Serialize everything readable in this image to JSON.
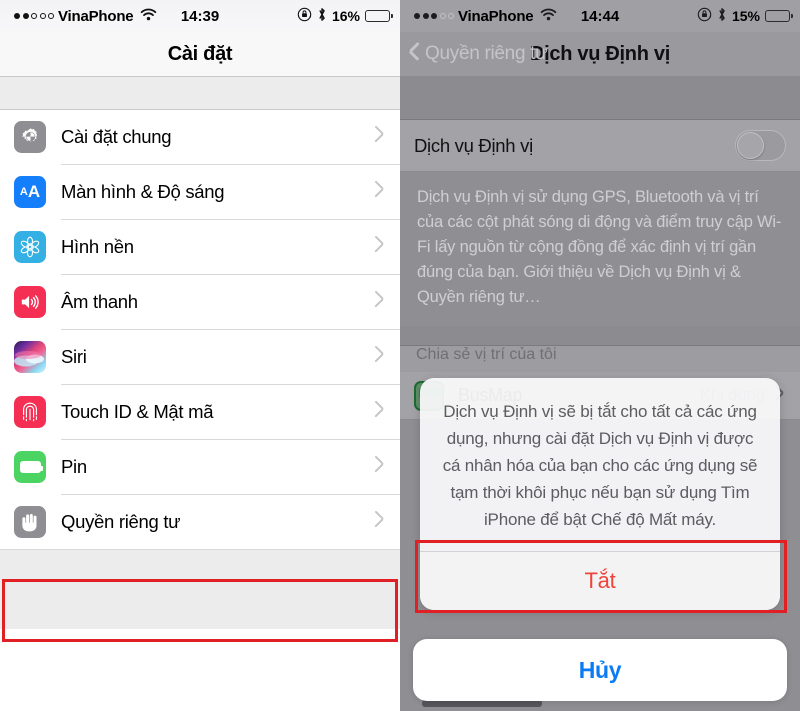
{
  "left": {
    "statusbar": {
      "signal_dots_filled": 2,
      "signal_dots_total": 5,
      "carrier": "VinaPhone",
      "wifi_icon": "wifi-icon",
      "time": "14:39",
      "rotation_lock_icon": "rotation-lock-icon",
      "bluetooth_icon": "bluetooth-icon",
      "battery_percent": "16%",
      "battery_level": 16,
      "battery_color": "#ffcc00"
    },
    "nav": {
      "title": "Cài đặt"
    },
    "list": [
      {
        "label": "Cài đặt chung",
        "icon": "gear-icon",
        "color": "#8e8e93"
      },
      {
        "label": "Màn hình & Độ sáng",
        "icon": "display-aa-icon",
        "color": "#147efb"
      },
      {
        "label": "Hình nền",
        "icon": "wallpaper-icon",
        "color": "#35b0e4"
      },
      {
        "label": "Âm thanh",
        "icon": "speaker-icon",
        "color": "#f52f53"
      },
      {
        "label": "Siri",
        "icon": "siri-icon",
        "color": "#6a2ea0"
      },
      {
        "label": "Touch ID & Mật mã",
        "icon": "fingerprint-icon",
        "color": "#f52f53"
      },
      {
        "label": "Pin",
        "icon": "battery-icon",
        "color": "#4cd462"
      },
      {
        "label": "Quyền riêng tư",
        "icon": "hand-icon",
        "color": "#8e8e93"
      }
    ],
    "highlight": {
      "target_label": "Quyền riêng tư",
      "color": "#e12026"
    }
  },
  "right": {
    "statusbar": {
      "signal_dots_filled": 3,
      "signal_dots_total": 5,
      "carrier": "VinaPhone",
      "wifi_icon": "wifi-icon",
      "time": "14:44",
      "rotation_lock_icon": "rotation-lock-icon",
      "bluetooth_icon": "bluetooth-icon",
      "battery_percent": "15%",
      "battery_level": 15,
      "battery_color": "#ffcc00"
    },
    "nav": {
      "back_label": "Quyền riêng tư",
      "title": "Dịch vụ Định vị"
    },
    "toggle_row": {
      "label": "Dịch vụ Định vị",
      "state": "off"
    },
    "description": "Dịch vụ Định vị sử dụng GPS, Bluetooth và vị trí của các cột phát sóng di động và điểm truy cập Wi-Fi lấy nguồn từ cộng đồng để xác định vị trí gần đúng của bạn. Giới thiệu về Dịch vụ Định vị & Quyền riêng tư…",
    "obscured_section_header": "Chia sẻ vị trí của tôi",
    "app_row": {
      "name": "BusMap",
      "status": "Khi dùng",
      "icon": "busmap-icon"
    },
    "alert": {
      "message": "Dịch vụ Định vị sẽ bị tắt cho tất cả các ứng dụng, nhưng cài đặt Dịch vụ Định vị được cá nhân hóa của bạn cho các ứng dụng sẽ tạm thời khôi phục nếu bạn sử dụng Tìm iPhone để bật Chế độ Mất máy.",
      "confirm_label": "Tắt",
      "confirm_color": "#f0433a",
      "cancel_label": "Hủy",
      "cancel_color": "#0a7bf4"
    },
    "highlight": {
      "target_label": "Tắt",
      "color": "#e12026"
    }
  }
}
